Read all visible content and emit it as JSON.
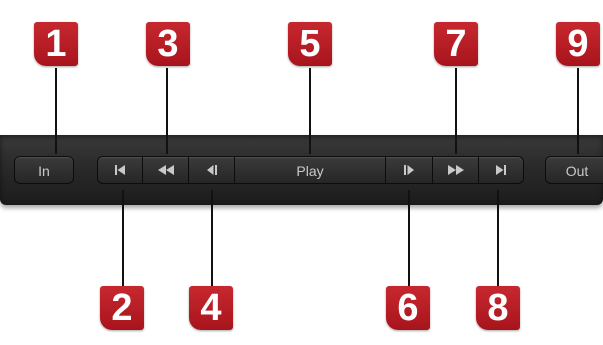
{
  "callouts": [
    "1",
    "2",
    "3",
    "4",
    "5",
    "6",
    "7",
    "8",
    "9"
  ],
  "transport": {
    "in_label": "In",
    "play_label": "Play",
    "out_label": "Out",
    "icons": {
      "go_to_start": "skip-to-start-icon",
      "rewind": "rewind-icon",
      "step_back": "step-back-icon",
      "step_forward": "step-forward-icon",
      "fast_forward": "fast-forward-icon",
      "go_to_end": "skip-to-end-icon"
    }
  },
  "colors": {
    "callout_red": "#b81d25",
    "toolbar_bg": "#2a2a2a",
    "button_text": "#c9c9c9"
  }
}
